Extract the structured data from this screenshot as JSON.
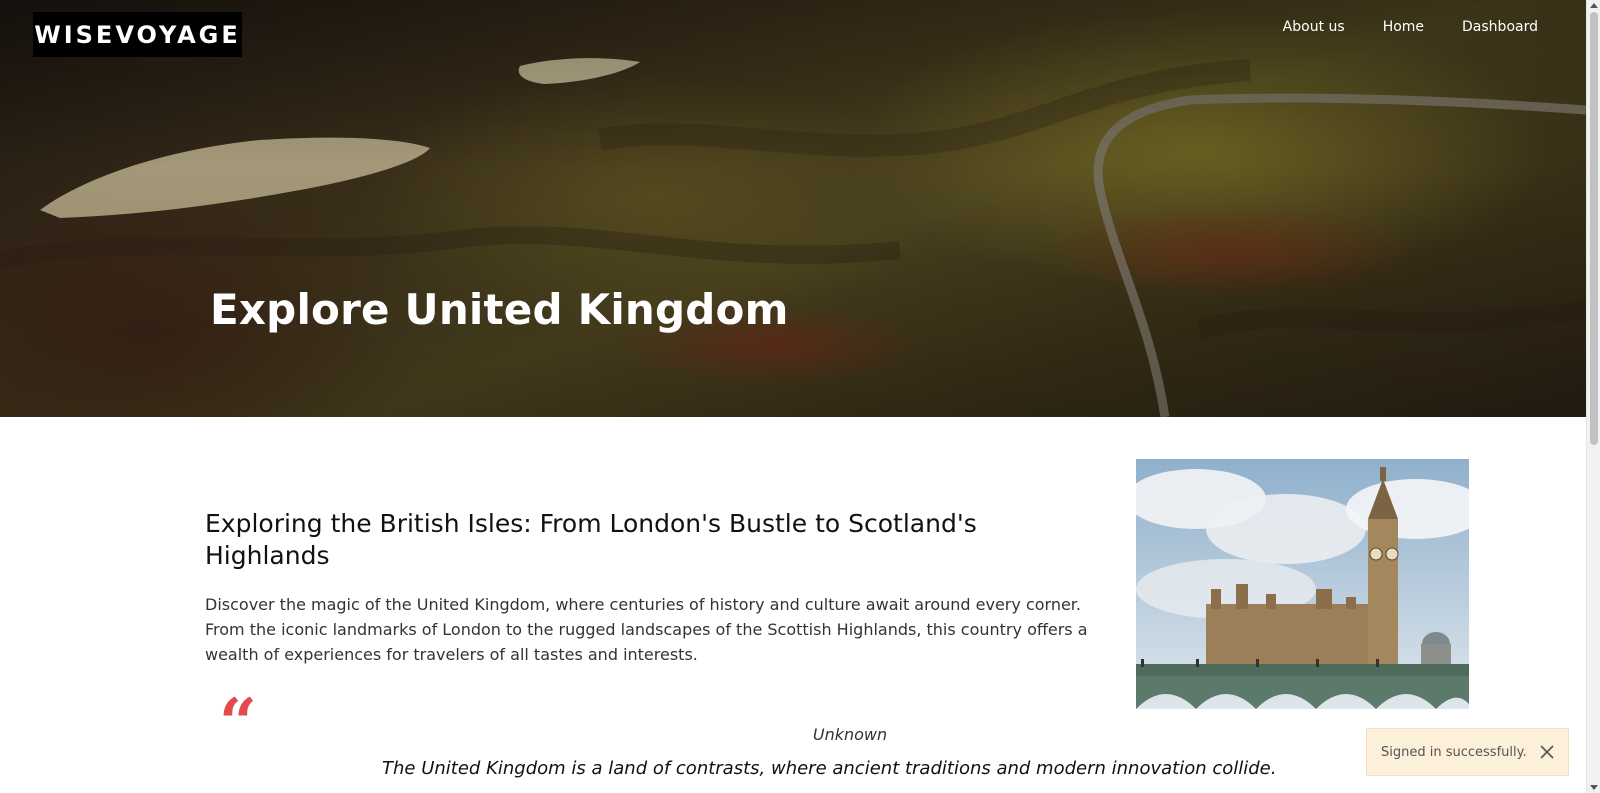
{
  "header": {
    "logo_text": "WISEVOYAGE",
    "nav": [
      {
        "label": "About us"
      },
      {
        "label": "Home"
      },
      {
        "label": "Dashboard"
      }
    ]
  },
  "hero": {
    "title": "Explore United Kingdom"
  },
  "article": {
    "heading": "Exploring the British Isles: From London's Bustle to Scotland's Highlands",
    "body": "Discover the magic of the United Kingdom, where centuries of history and culture await around every corner. From the iconic landmarks of London to the rugged landscapes of the Scottish Highlands, this country offers a wealth of experiences for travelers of all tastes and interests."
  },
  "quote": {
    "mark": "“",
    "author": "Unknown",
    "text": "The United Kingdom is a land of contrasts, where ancient traditions and modern innovation collide."
  },
  "toast": {
    "message": "Signed in successfully."
  },
  "colors": {
    "quote_accent": "#e24b4b",
    "toast_bg": "#fdf0db"
  }
}
